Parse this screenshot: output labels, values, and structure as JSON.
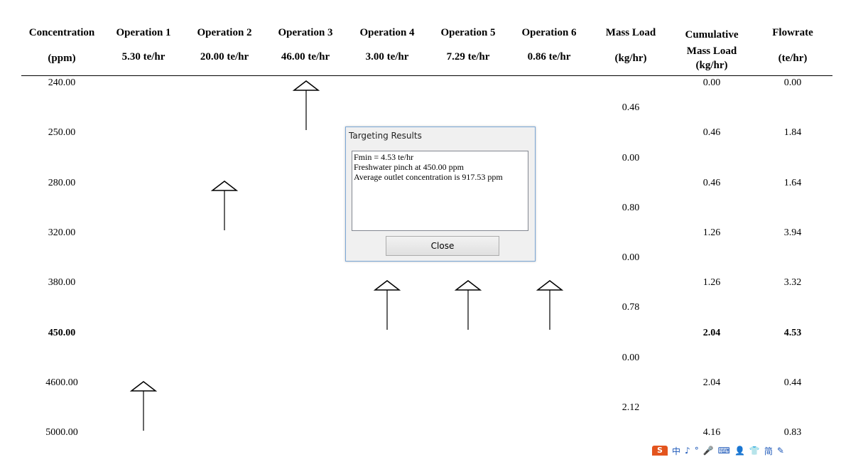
{
  "headers": [
    {
      "line1": "Concentration",
      "line2": "",
      "line3": "(ppm)"
    },
    {
      "line1": "Operation 1",
      "line2": "",
      "line3": "5.30 te/hr"
    },
    {
      "line1": "Operation 2",
      "line2": "",
      "line3": "20.00 te/hr"
    },
    {
      "line1": "Operation 3",
      "line2": "",
      "line3": "46.00 te/hr"
    },
    {
      "line1": "Operation 4",
      "line2": "",
      "line3": "3.00 te/hr"
    },
    {
      "line1": "Operation 5",
      "line2": "",
      "line3": "7.29 te/hr"
    },
    {
      "line1": "Operation 6",
      "line2": "",
      "line3": "0.86 te/hr"
    },
    {
      "line1": "Mass Load",
      "line2": "",
      "line3": "(kg/hr)"
    },
    {
      "line1": "Cumulative",
      "line2": "Mass Load",
      "line3": "(kg/hr)"
    },
    {
      "line1": "Flowrate",
      "line2": "",
      "line3": "(te/hr)"
    }
  ],
  "concentrations": [
    "240.00",
    "250.00",
    "280.00",
    "320.00",
    "380.00",
    "450.00",
    "4600.00",
    "5000.00"
  ],
  "mass_loads": [
    "0.46",
    "0.00",
    "0.80",
    "0.00",
    "0.78",
    "0.00",
    "2.12"
  ],
  "cumulative_mass_loads": [
    "0.00",
    "0.46",
    "0.46",
    "1.26",
    "1.26",
    "2.04",
    "2.04",
    "4.16"
  ],
  "flowrates": [
    "0.00",
    "1.84",
    "1.64",
    "3.94",
    "3.32",
    "4.53",
    "0.44",
    "0.83"
  ],
  "pinch_row_index": 5,
  "arrows": [
    {
      "operation": "Operation 1",
      "from_ppm": "5000.00",
      "to_ppm": "4600.00"
    },
    {
      "operation": "Operation 2",
      "from_ppm": "320.00",
      "to_ppm": "280.00"
    },
    {
      "operation": "Operation 3",
      "from_ppm": "250.00",
      "to_ppm": "240.00"
    },
    {
      "operation": "Operation 4",
      "from_ppm": "450.00",
      "to_ppm": "380.00"
    },
    {
      "operation": "Operation 5",
      "from_ppm": "450.00",
      "to_ppm": "380.00"
    },
    {
      "operation": "Operation 6",
      "from_ppm": "450.00",
      "to_ppm": "380.00"
    }
  ],
  "dialog": {
    "title": "Targeting Results",
    "lines": [
      "Fmin = 4.53 te/hr",
      "Freshwater pinch at 450.00 ppm",
      "Average outlet concentration is 917.53 ppm"
    ],
    "close_label": "Close"
  },
  "tray": {
    "logo": "S",
    "items": [
      "中",
      "♪",
      "°",
      "🎤",
      "⌨",
      "👤",
      "👕",
      "简",
      "✎"
    ]
  },
  "colors": {
    "dialog_border": "#7aa7d6",
    "tray_logo": "#e3541d"
  }
}
